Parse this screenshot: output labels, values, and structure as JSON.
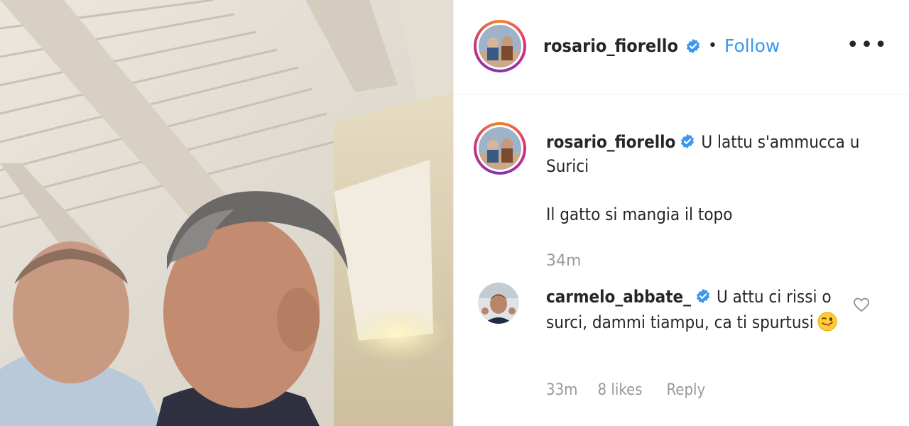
{
  "post": {
    "username": "rosario_fiorello",
    "follow_label": "Follow",
    "separator": "•",
    "more_label": "•••"
  },
  "caption": {
    "username": "rosario_fiorello",
    "text": "U lattu s'ammucca u Surici",
    "translation": "Il gatto si mangia il topo",
    "time": "34m"
  },
  "comment": {
    "username": "carmelo_abbate_",
    "text": "U attu ci rissi o surci, dammi tiampu, ca ti spurtusi",
    "emoji": "winking-face-with-tongue",
    "time": "33m",
    "likes": "8 likes",
    "reply_label": "Reply"
  },
  "colors": {
    "link": "#3897f0",
    "verified": "#3897f0",
    "muted": "#999999",
    "text": "#262626"
  }
}
